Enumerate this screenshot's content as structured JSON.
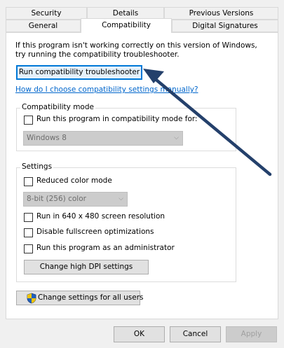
{
  "tabs": {
    "row1": [
      "Security",
      "Details",
      "Previous Versions"
    ],
    "row2": [
      "General",
      "Compatibility",
      "Digital Signatures"
    ]
  },
  "intro": {
    "line1": "If this program isn't working correctly on this version of Windows,",
    "line2": "try running the compatibility troubleshooter."
  },
  "run_troubleshooter_label": "Run compatibility troubleshooter",
  "help_link": "How do I choose compatibility settings manually?",
  "compat_mode": {
    "title": "Compatibility mode",
    "checkbox_label": "Run this program in compatibility mode for:",
    "checked": false,
    "os_selected": "Windows 8"
  },
  "settings": {
    "title": "Settings",
    "reduced_color_label": "Reduced color mode",
    "color_selected": "8-bit (256) color",
    "res_640_label": "Run in 640 x 480 screen resolution",
    "disable_fullscreen_label": "Disable fullscreen optimizations",
    "run_admin_label": "Run this program as an administrator",
    "high_dpi_label": "Change high DPI settings"
  },
  "change_all_users_label": "Change settings for all users",
  "footer": {
    "ok": "OK",
    "cancel": "Cancel",
    "apply": "Apply"
  },
  "colors": {
    "accent": "#0078d7",
    "link": "#0066cc",
    "annotation_arrow": "#24406b"
  },
  "icons": {
    "shield": "uac-shield-icon",
    "dropdown": "chevron-down-icon"
  }
}
